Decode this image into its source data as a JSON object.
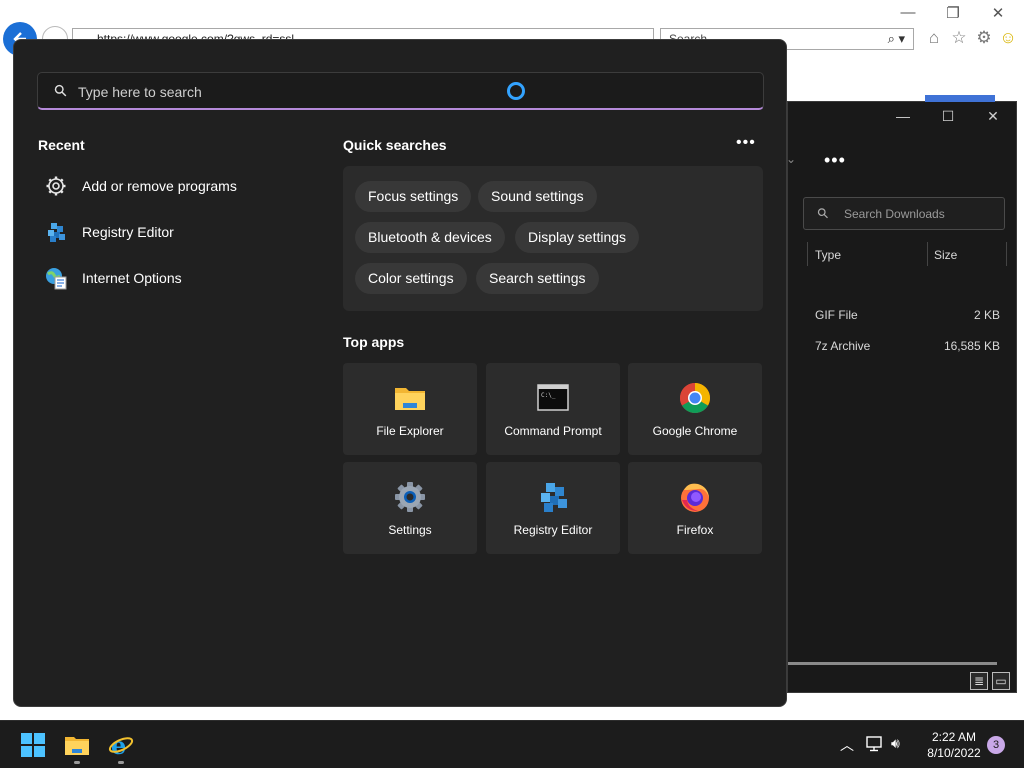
{
  "ie": {
    "address": "https://www.google.com/?gws_rd=ssl",
    "search_placeholder": "Search",
    "window_controls": [
      "minimize",
      "restore",
      "close"
    ],
    "toolbar_icons": [
      "home-icon",
      "favorites-star-icon",
      "tools-gear-icon",
      "smiley-feedback-icon"
    ]
  },
  "file_explorer": {
    "search_placeholder": "Search Downloads",
    "columns": [
      "Type",
      "Size"
    ],
    "rows": [
      {
        "type": "GIF File",
        "size": "2 KB"
      },
      {
        "type": "7z Archive",
        "size": "16,585 KB"
      }
    ]
  },
  "search_panel": {
    "placeholder": "Type here to search",
    "recent": {
      "title": "Recent",
      "items": [
        {
          "label": "Add or remove programs",
          "icon": "gear-icon"
        },
        {
          "label": "Registry Editor",
          "icon": "registry-editor-icon"
        },
        {
          "label": "Internet Options",
          "icon": "internet-options-icon"
        }
      ]
    },
    "quick_searches": {
      "title": "Quick searches",
      "items": [
        "Focus settings",
        "Sound settings",
        "Bluetooth & devices",
        "Display settings",
        "Color settings",
        "Search settings"
      ]
    },
    "top_apps": {
      "title": "Top apps",
      "items": [
        {
          "label": "File Explorer",
          "icon": "folder-icon"
        },
        {
          "label": "Command Prompt",
          "icon": "command-prompt-icon"
        },
        {
          "label": "Google Chrome",
          "icon": "chrome-icon"
        },
        {
          "label": "Settings",
          "icon": "settings-gear-icon"
        },
        {
          "label": "Registry Editor",
          "icon": "registry-editor-icon"
        },
        {
          "label": "Firefox",
          "icon": "firefox-icon"
        }
      ]
    }
  },
  "taskbar": {
    "time": "2:22 AM",
    "date": "8/10/2022",
    "notification_count": "3",
    "pinned": [
      "start-icon",
      "file-explorer-icon",
      "internet-explorer-icon"
    ]
  },
  "colors": {
    "accent": "#b58ad9",
    "cortana": "#33a3ff",
    "panel_bg": "#202020"
  }
}
